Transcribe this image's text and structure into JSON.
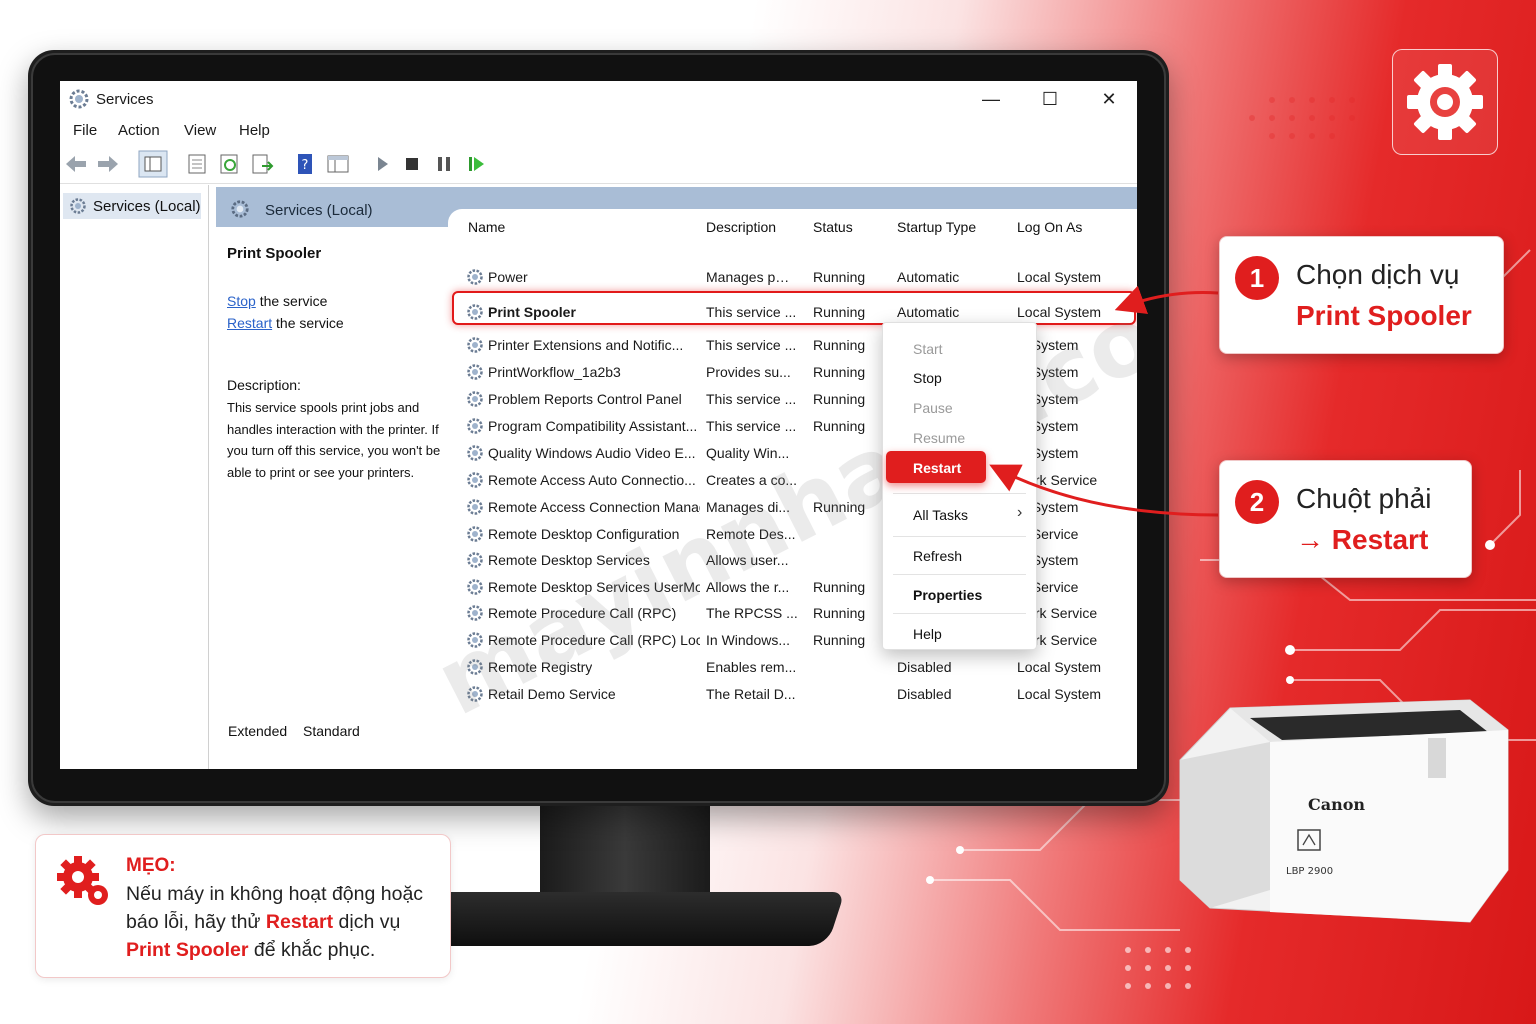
{
  "window": {
    "title": "Services",
    "minimize": "—",
    "maximize": "☐",
    "close": "✕"
  },
  "menu": [
    "File",
    "Action",
    "View",
    "Help"
  ],
  "toolbar_icons": [
    "back-arrow-icon",
    "forward-arrow-icon",
    "console-tree-icon",
    "properties-icon",
    "refresh-icon",
    "export-list-icon",
    "help-icon",
    "mmc-view-icon",
    "start-service-icon",
    "stop-service-icon",
    "pause-service-icon",
    "resume-service-icon"
  ],
  "tree": {
    "root": "Services (Local)"
  },
  "pane": {
    "header": "Services (Local)",
    "selected_service": "Print Spooler",
    "stop_link": "Stop",
    "stop_suffix": " the service",
    "restart_link": "Restart",
    "restart_suffix": " the service",
    "description_label": "Description:",
    "description_text": "This service spools print jobs and handles interaction with the printer. If you turn off this service, you won't be able to print or see your printers."
  },
  "columns": [
    "Name",
    "Description",
    "Status",
    "Startup Type",
    "Log On As"
  ],
  "services": [
    {
      "name": "Power",
      "description": "Manages p…",
      "status": "Running",
      "startup": "Automatic",
      "logon": "Local System"
    },
    {
      "name": "Print Spooler",
      "description": "This service ...",
      "status": "Running",
      "startup": "Automatic",
      "logon": "Local System"
    },
    {
      "name": "Printer Extensions and Notific...",
      "description": "This service ...",
      "status": "Running",
      "startup": "",
      "logon": "al System"
    },
    {
      "name": "PrintWorkflow_1a2b3",
      "description": "Provides su...",
      "status": "Running",
      "startup": "",
      "logon": "al System"
    },
    {
      "name": "Problem Reports Control Panel",
      "description": "This service ...",
      "status": "Running",
      "startup": "",
      "logon": "al System"
    },
    {
      "name": "Program Compatibility Assistant...",
      "description": "This service ...",
      "status": "Running",
      "startup": "",
      "logon": "al System"
    },
    {
      "name": "Quality Windows Audio Video E...",
      "description": "Quality Win...",
      "status": "",
      "startup": "",
      "logon": "al System"
    },
    {
      "name": "Remote Access Auto Connectio...",
      "description": "Creates a co...",
      "status": "",
      "startup": "",
      "logon": "work Service"
    },
    {
      "name": "Remote Access Connection Manager",
      "description": "Manages di...",
      "status": "Running",
      "startup": "",
      "logon": "al System"
    },
    {
      "name": "Remote Desktop Configuration",
      "description": "Remote Des...",
      "status": "",
      "startup": "",
      "logon": "al Service"
    },
    {
      "name": "Remote Desktop Services",
      "description": "Allows user...",
      "status": "",
      "startup": "",
      "logon": "al System"
    },
    {
      "name": "Remote Desktop Services UserMo...",
      "description": "Allows the r...",
      "status": "Running",
      "startup": "",
      "logon": "al Service"
    },
    {
      "name": "Remote Procedure Call (RPC)",
      "description": "The RPCSS ...",
      "status": "Running",
      "startup": "",
      "logon": "work Service"
    },
    {
      "name": "Remote Procedure Call (RPC) Loc...",
      "description": "In Windows...",
      "status": "Running",
      "startup": "",
      "logon": "work Service"
    },
    {
      "name": "Remote Registry",
      "description": "Enables rem...",
      "status": "",
      "startup": "Disabled",
      "logon": "Local System"
    },
    {
      "name": "Retail Demo Service",
      "description": "The Retail D...",
      "status": "",
      "startup": "Disabled",
      "logon": "Local System"
    }
  ],
  "bottom_tabs": [
    "Extended",
    "Standard"
  ],
  "context_menu": {
    "start": "Start",
    "stop": "Stop",
    "pause": "Pause",
    "resume": "Resume",
    "restart": "Restart",
    "all_tasks": "All Tasks",
    "refresh": "Refresh",
    "properties": "Properties",
    "help": "Help"
  },
  "callout1": {
    "number": "1",
    "line1": "Chọn dịch vụ",
    "line2": "Print Spooler"
  },
  "callout2": {
    "number": "2",
    "line1": "Chuột phải",
    "line2": "→ Restart"
  },
  "tip": {
    "heading": "MẸO:",
    "text_a": "Nếu máy in không hoạt động hoặc báo lỗi, hãy thử ",
    "text_b": "Restart",
    "text_c": " dịch vụ ",
    "text_d": "Print Spooler",
    "text_e": " để khắc phục."
  },
  "printer": {
    "brand": "Canon",
    "model": "LBP 2900"
  },
  "watermark": "mayinnhanh.com",
  "colors": {
    "accent": "#e01e1e",
    "pane_header": "#a9bdd6",
    "link": "#2a62c9"
  }
}
